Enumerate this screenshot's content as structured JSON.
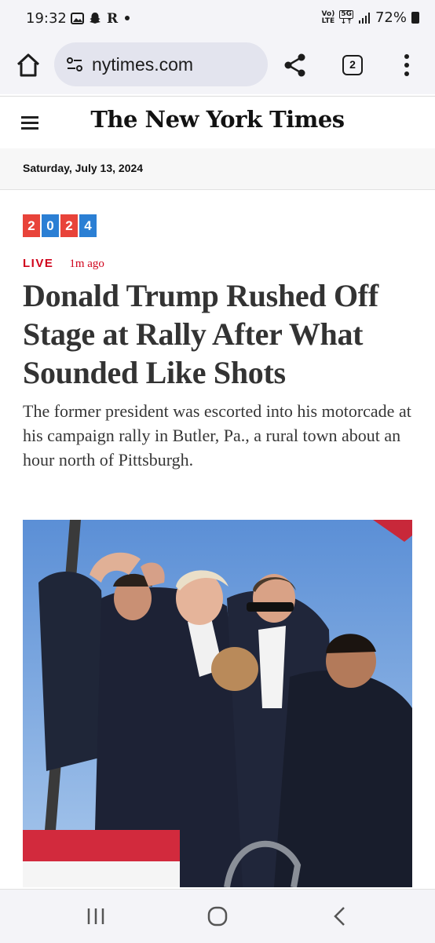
{
  "status_bar": {
    "time": "19:32",
    "network_top": "Vo)",
    "network_bottom": "LTE",
    "gen_top": "5G",
    "battery": "72%"
  },
  "browser": {
    "url": "nytimes.com",
    "tab_count": "2"
  },
  "header": {
    "masthead": "The New York Times"
  },
  "date_bar": {
    "date": "Saturday, July 13, 2024"
  },
  "article": {
    "badge_digits": [
      "2",
      "0",
      "2",
      "4"
    ],
    "live_label": "LIVE",
    "time_ago": "1m ago",
    "headline": "Donald Trump Rushed Off Stage at Rally After What Sounded Like Shots",
    "summary": "The former president was escorted into his motorcade at his campaign rally in Butler, Pa., a rural town about an hour north of Pittsburgh."
  },
  "colors": {
    "live_red": "#d0021b",
    "badge_red": "#e8433a",
    "badge_blue": "#2b7fd4"
  }
}
